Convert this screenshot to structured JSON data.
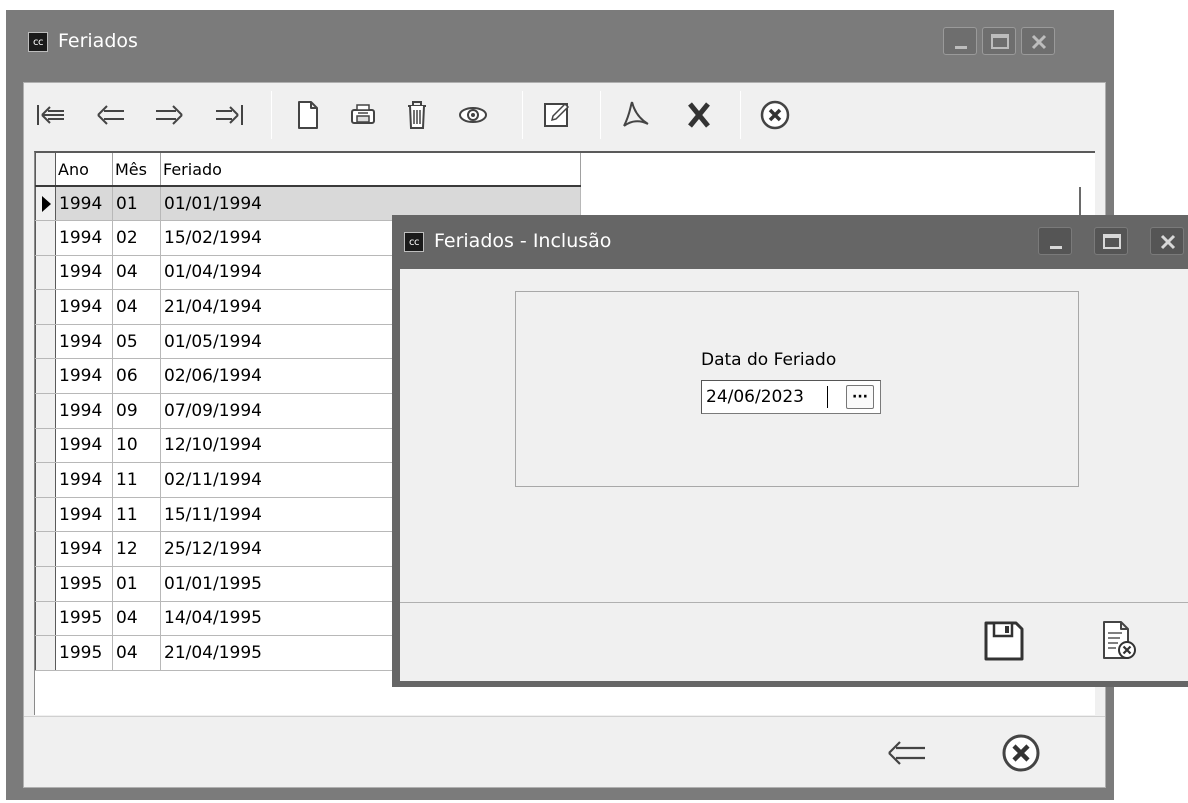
{
  "main_window": {
    "icon_label": "cc",
    "title": "Feriados",
    "toolbar_icons": [
      "first-record-icon",
      "previous-record-icon",
      "next-record-icon",
      "last-record-icon",
      "new-document-icon",
      "print-icon",
      "trash-icon",
      "eye-icon",
      "edit-icon",
      "pdf-icon",
      "excel-icon",
      "close-circle-icon"
    ],
    "grid": {
      "columns": [
        "Ano",
        "Mês",
        "Feriado"
      ],
      "rows": [
        {
          "ano": "1994",
          "mes": "01",
          "feriado": "01/01/1994"
        },
        {
          "ano": "1994",
          "mes": "02",
          "feriado": "15/02/1994"
        },
        {
          "ano": "1994",
          "mes": "04",
          "feriado": "01/04/1994"
        },
        {
          "ano": "1994",
          "mes": "04",
          "feriado": "21/04/1994"
        },
        {
          "ano": "1994",
          "mes": "05",
          "feriado": "01/05/1994"
        },
        {
          "ano": "1994",
          "mes": "06",
          "feriado": "02/06/1994"
        },
        {
          "ano": "1994",
          "mes": "09",
          "feriado": "07/09/1994"
        },
        {
          "ano": "1994",
          "mes": "10",
          "feriado": "12/10/1994"
        },
        {
          "ano": "1994",
          "mes": "11",
          "feriado": "02/11/1994"
        },
        {
          "ano": "1994",
          "mes": "11",
          "feriado": "15/11/1994"
        },
        {
          "ano": "1994",
          "mes": "12",
          "feriado": "25/12/1994"
        },
        {
          "ano": "1995",
          "mes": "01",
          "feriado": "01/01/1995"
        },
        {
          "ano": "1995",
          "mes": "04",
          "feriado": "14/04/1995"
        },
        {
          "ano": "1995",
          "mes": "04",
          "feriado": "21/04/1995"
        }
      ]
    },
    "bottom_icons": [
      "back-arrow-icon",
      "close-circle-icon"
    ]
  },
  "dialog": {
    "icon_label": "cc",
    "title": "Feriados - Inclusão",
    "date_label": "Data do Feriado",
    "date_value": "24/06/2023",
    "picker_label": "···",
    "footer_icons": [
      "save-floppy-icon",
      "cancel-document-icon"
    ]
  },
  "colors": {
    "titlebar_main": "#7b7b7b",
    "titlebar_dialog": "#666666",
    "window_bg": "#f0f0f0",
    "grid_selected_row": "#d9d9d9"
  }
}
